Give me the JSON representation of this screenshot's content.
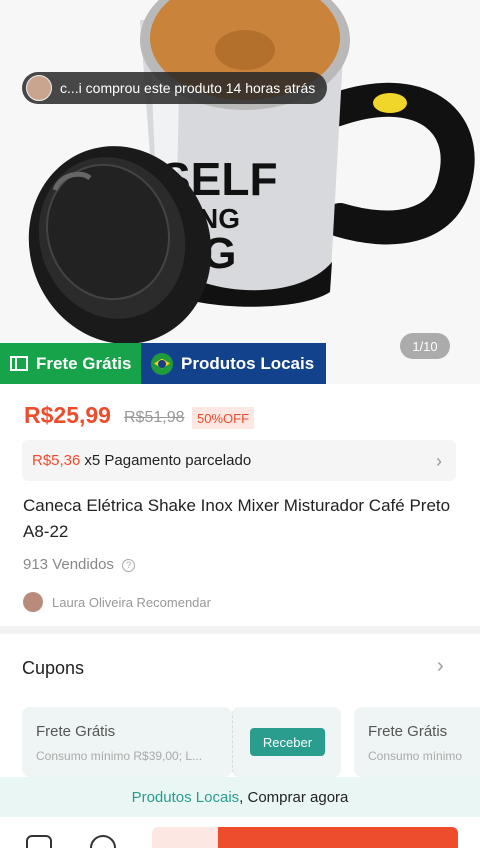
{
  "hero": {
    "toast": "c...i comprou este produto 14 horas atrás",
    "counter": "1/10",
    "badge_frete": "Frete Grátis",
    "badge_local": "Produtos Locais"
  },
  "product": {
    "price": "R$25,99",
    "old_price": "R$51,98",
    "discount": "50%OFF",
    "installment_amount": "R$5,36",
    "installment_text": "x5 Pagamento parcelado",
    "title": "Caneca Elétrica Shake Inox Mixer Misturador Café Preto A8-22",
    "sold": "913 Vendidos",
    "recommend": "Laura Oliveira Recomendar"
  },
  "coupons": {
    "title": "Cupons",
    "cards": [
      {
        "title": "Frete Grátis",
        "subtitle": "Consumo mínimo R$39,00; L..."
      },
      {
        "title": "Frete Grátis",
        "subtitle": "Consumo mínimo"
      }
    ],
    "receive_label": "Receber"
  },
  "banner": {
    "link": "Produtos Locais",
    "action": ", Comprar agora"
  },
  "colors": {
    "brand": "#ee4d2d",
    "green": "#16a34a",
    "blue": "#12428c",
    "teal": "#2a9d8f"
  }
}
